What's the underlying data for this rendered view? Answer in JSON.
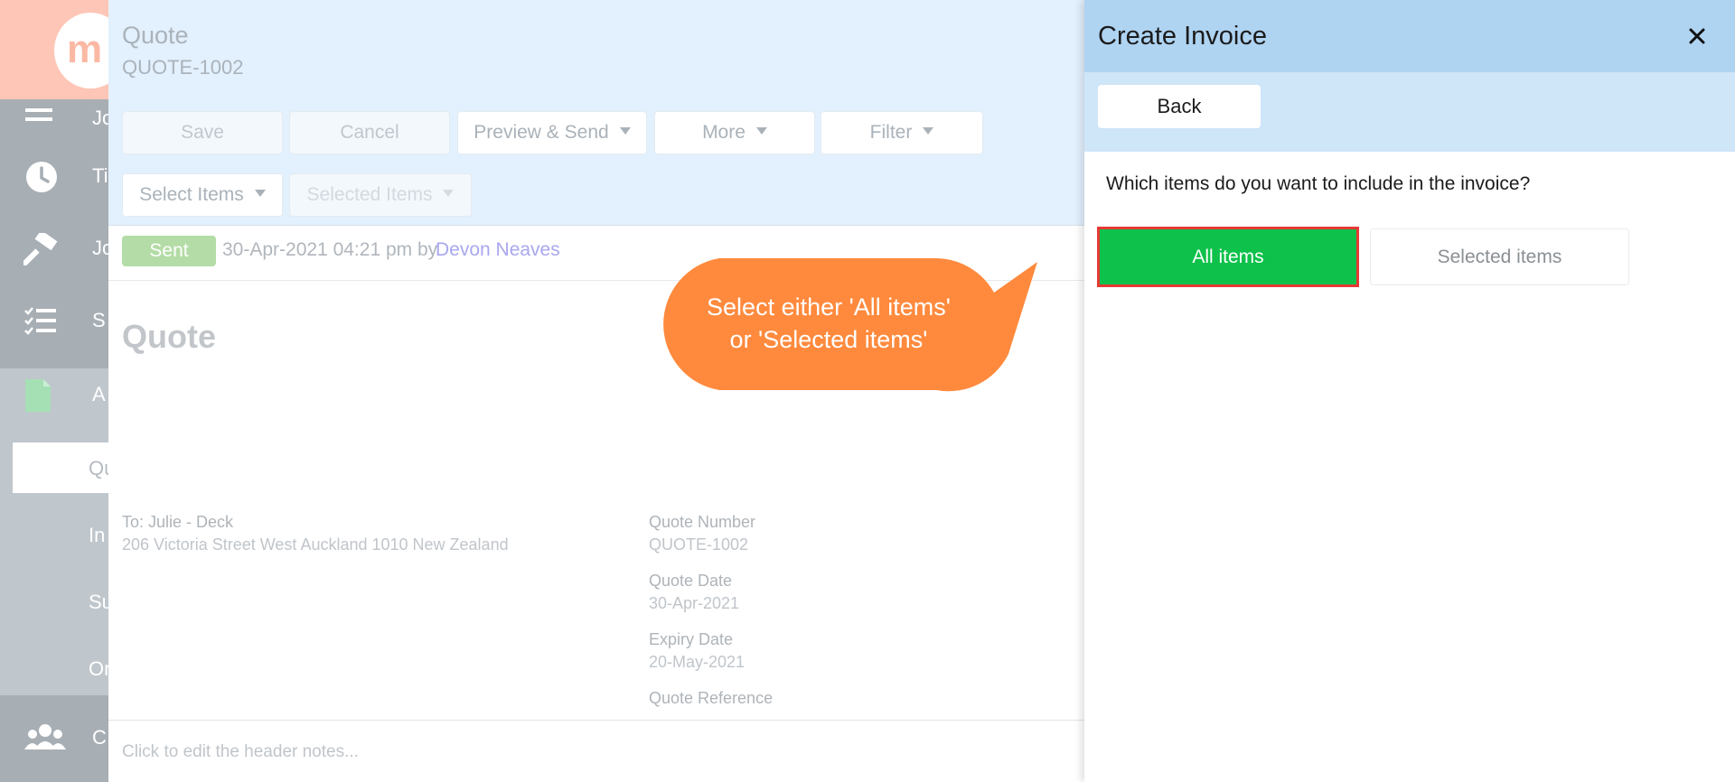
{
  "sidebar": {
    "logo_text": "m",
    "items": [
      {
        "label": "Jo",
        "icon": "menu-icon"
      },
      {
        "label": "Ti",
        "icon": "clock-icon"
      },
      {
        "label": "Jo",
        "icon": "hammer-icon"
      },
      {
        "label": "S",
        "icon": "checklist-icon"
      },
      {
        "label": "A",
        "icon": "document-icon"
      }
    ],
    "subitems": [
      {
        "label": "Qu",
        "active": true
      },
      {
        "label": "In",
        "active": false
      },
      {
        "label": "Su",
        "active": false
      },
      {
        "label": "Or",
        "active": false
      }
    ],
    "bottom_item": {
      "label": "C",
      "icon": "users-icon"
    }
  },
  "quote": {
    "label": "Quote",
    "number": "QUOTE-1002"
  },
  "toolbar": {
    "save": "Save",
    "cancel": "Cancel",
    "preview_send": "Preview & Send",
    "more": "More",
    "filter": "Filter",
    "select_items": "Select Items",
    "selected_items": "Selected Items"
  },
  "status": {
    "badge": "Sent",
    "text": "30-Apr-2021 04:21 pm by",
    "user": "Devon Neaves"
  },
  "document": {
    "title": "Quote",
    "to_label": "To: Julie - Deck",
    "address": "206 Victoria Street West Auckland 1010 New Zealand",
    "quote_number_label": "Quote Number",
    "quote_number_value": "QUOTE-1002",
    "quote_date_label": "Quote Date",
    "quote_date_value": "30-Apr-2021",
    "expiry_date_label": "Expiry Date",
    "expiry_date_value": "20-May-2021",
    "quote_reference_label": "Quote Reference",
    "header_notes_placeholder": "Click to edit the header notes..."
  },
  "callout": {
    "line1": "Select either 'All items'",
    "line2": "or 'Selected items'",
    "color": "#ff8a3d"
  },
  "panel": {
    "title": "Create Invoice",
    "back": "Back",
    "question": "Which items do you want to include in the invoice?",
    "all_items": "All items",
    "selected_items": "Selected items",
    "accent": "#0dc14a",
    "highlight": "#e53935"
  }
}
